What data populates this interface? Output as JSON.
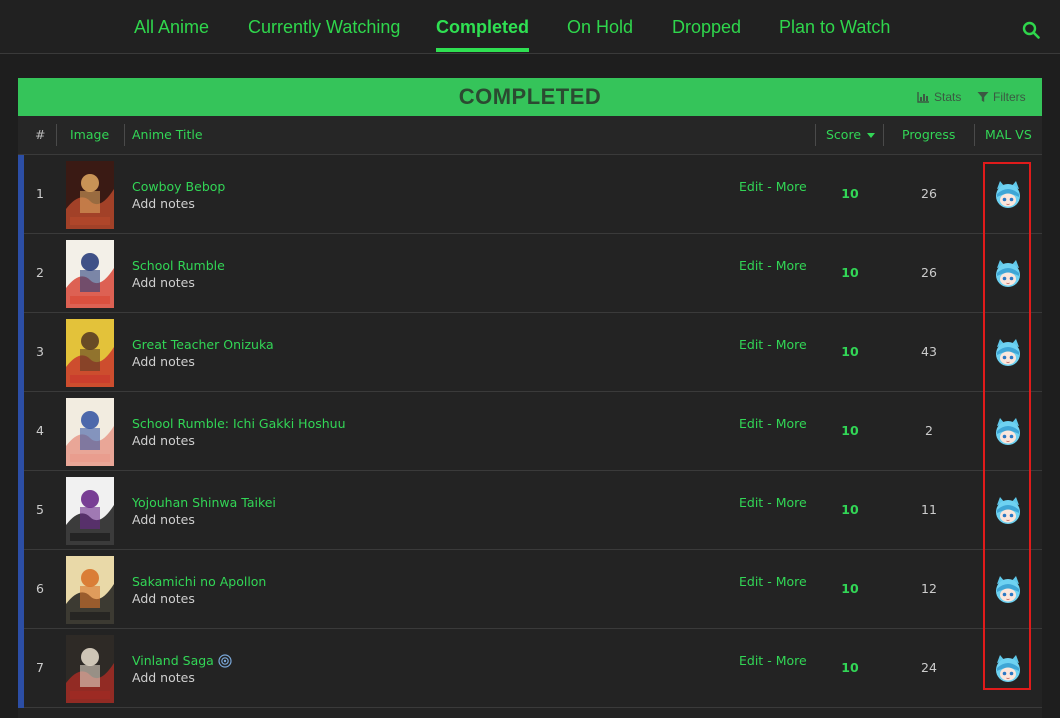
{
  "nav": {
    "tabs": [
      "All Anime",
      "Currently Watching",
      "Completed",
      "On Hold",
      "Dropped",
      "Plan to Watch"
    ],
    "active_tab": "Completed"
  },
  "list": {
    "status_title": "COMPLETED",
    "stats_label": "Stats",
    "filters_label": "Filters"
  },
  "columns": {
    "num": "#",
    "image": "Image",
    "title": "Anime Title",
    "score": "Score",
    "progress": "Progress",
    "mal_vs": "MAL VS"
  },
  "actions": {
    "edit": "Edit",
    "sep": "-",
    "more": "More"
  },
  "rows": [
    {
      "num": "1",
      "title": "Cowboy Bebop",
      "notes": "Add notes",
      "score": "10",
      "progress": "26",
      "cover": [
        "#3a1a14",
        "#b5492b",
        "#d8a15d"
      ]
    },
    {
      "num": "2",
      "title": "School Rumble",
      "notes": "Add notes",
      "score": "10",
      "progress": "26",
      "cover": [
        "#f3f0e8",
        "#d84838",
        "#2b3f7c"
      ]
    },
    {
      "num": "3",
      "title": "Great Teacher Onizuka",
      "notes": "Add notes",
      "score": "10",
      "progress": "43",
      "cover": [
        "#e3c23a",
        "#c9382d",
        "#5a3d24"
      ]
    },
    {
      "num": "4",
      "title": "School Rumble: Ichi Gakki Hoshuu",
      "notes": "Add notes",
      "score": "10",
      "progress": "2",
      "cover": [
        "#f2ece0",
        "#e89a8a",
        "#3b5aa5"
      ]
    },
    {
      "num": "5",
      "title": "Yojouhan Shinwa Taikei",
      "notes": "Add notes",
      "score": "10",
      "progress": "11",
      "cover": [
        "#f1f1f1",
        "#1b1b1b",
        "#6a2a8a"
      ]
    },
    {
      "num": "6",
      "title": "Sakamichi no Apollon",
      "notes": "Add notes",
      "score": "10",
      "progress": "12",
      "cover": [
        "#e9d9a8",
        "#1d1d1d",
        "#d8732a"
      ]
    },
    {
      "num": "7",
      "title": "Vinland Saga",
      "notes": "Add notes",
      "score": "10",
      "progress": "24",
      "cover": [
        "#2e2a26",
        "#a32b24",
        "#e0d6c7"
      ],
      "airing_icon": "broadcast-icon"
    }
  ],
  "colors": {
    "accent": "#32d656",
    "status_bar": "#35c45a",
    "stripe": "#2c4ea5",
    "highlight": "#e01b1b"
  },
  "icons": {
    "search": "search-icon",
    "stats": "bar-chart-icon",
    "filters": "funnel-icon",
    "sort": "caret-down-icon",
    "vs": "mascot-avatar-icon"
  }
}
